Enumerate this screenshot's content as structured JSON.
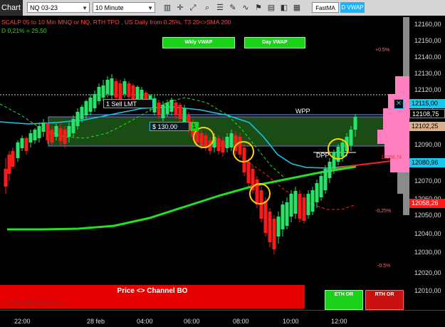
{
  "toolbar": {
    "chart_label": "Chart",
    "instrument": "NQ 03-23",
    "interval": "10 Minute",
    "fastma_label": "FastMA",
    "dvwap_label": "D VWAP"
  },
  "header": {
    "line1": "SCALP 05 to 10 Min MNQ or NQ, RTH TPO , US Daily from 0.25%, T3 20<>SMA 200",
    "line2": "D 0,21% = 25,50"
  },
  "buttons": {
    "wkly_vwap": "Wkly VWAP",
    "day_vwap": "Day VWAP",
    "eth_or": "ETH OR",
    "rth_or": "RTH OR"
  },
  "banner": {
    "text": "Price <> Channel BO"
  },
  "labels": {
    "sell_lmt": "1  Sell LMT",
    "order_pnl": "$ 130,00",
    "order_qty": "1",
    "wpp": "WPP",
    "dpp": "DPP",
    "copyright": "© 2023 NinjaTrader, LLC"
  },
  "percent_labels": {
    "p05": "+0.5%",
    "m025": "-0,25%",
    "m05": "-0.5%",
    "red_marker": "12086,74"
  },
  "y_axis": {
    "ticks": [
      "12160,00",
      "12150,00",
      "12140,00",
      "12130,00",
      "12120,00",
      "12110,00",
      "12100,00",
      "12090,00",
      "12080,00",
      "12070,00",
      "12060,00",
      "12050,00",
      "12040,00",
      "12030,00",
      "12020,00",
      "12010,00"
    ]
  },
  "price_boxes": {
    "box1": "12115,00",
    "box2": "12108,75",
    "box3": "12102,25",
    "box4": "12080,96",
    "box5": "12058,26"
  },
  "x_axis": {
    "ticks": [
      "22:00",
      "28 feb",
      "04:00",
      "06:00",
      "08:00",
      "10:00",
      "12:00"
    ]
  },
  "colors": {
    "bull": "#27e36a",
    "bear": "#ff1a1a",
    "vwap_cyan": "#19c8ee",
    "green_ma": "#24e024",
    "red_ma": "#ff2020",
    "profile": "#ff80c0",
    "channel": "#1f5a1a"
  }
}
